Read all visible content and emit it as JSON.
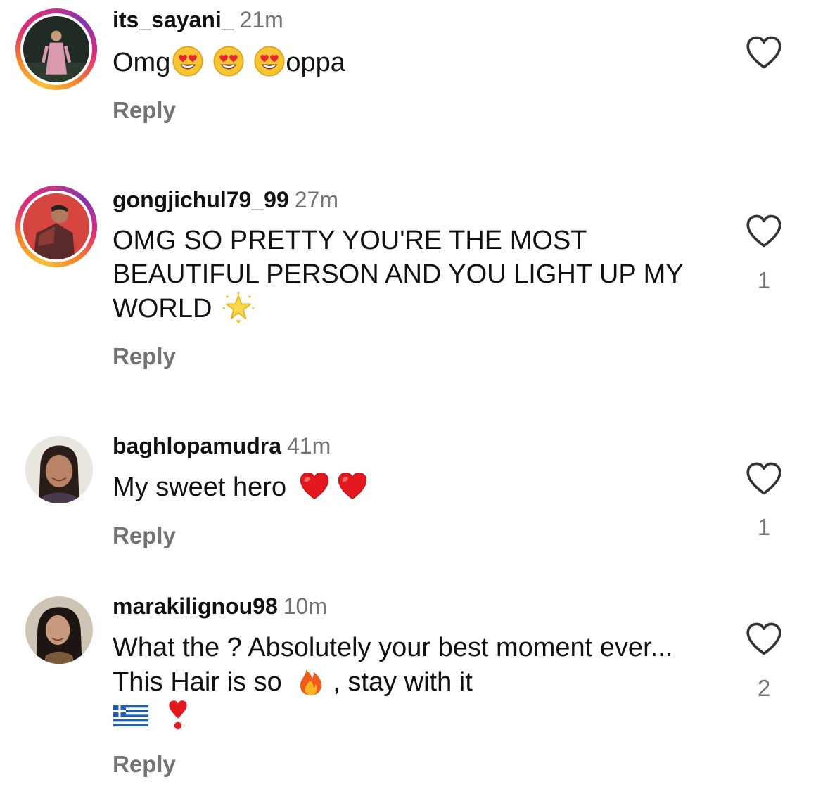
{
  "comments": [
    {
      "username": "its_sayani_",
      "time": "21m",
      "text_before": "Omg",
      "emojis": [
        "heart-eyes-emoji",
        "heart-eyes-emoji",
        "heart-eyes-emoji"
      ],
      "text_after": "oppa",
      "reply_label": "Reply",
      "like_count": ""
    },
    {
      "username": "gongjichul79_99",
      "time": "27m",
      "text": "OMG SO PRETTY YOU'RE THE MOST BEAUTIFUL PERSON AND YOU LIGHT UP MY WORLD",
      "emoji": "glowing-star-emoji",
      "reply_label": "Reply",
      "like_count": "1"
    },
    {
      "username": "baghlopamudra",
      "time": "41m",
      "text": "My sweet hero",
      "emojis": [
        "red-heart-emoji",
        "red-heart-emoji"
      ],
      "reply_label": "Reply",
      "like_count": "1"
    },
    {
      "username": "marakilignou98",
      "time": "10m",
      "text_before": "What the ? Absolutely your best moment ever... This Hair is so",
      "emoji_mid": "fire-emoji",
      "text_after": ", stay with it",
      "emojis_end": [
        "greece-flag-emoji",
        "red-exclamation-emoji"
      ],
      "reply_label": "Reply",
      "like_count": "2"
    }
  ],
  "colors": {
    "text": "#111111",
    "secondary": "#737373",
    "story_ring_start": "#f8c13a",
    "story_ring_end": "#c13584"
  }
}
